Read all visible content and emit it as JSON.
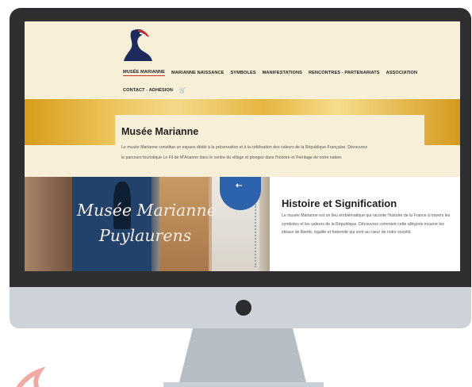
{
  "nav": {
    "items": [
      "MUSÉE MARIANNE",
      "MARIANNE NAISSANCE",
      "SYMBOLES",
      "MANIFESTATIONS",
      "RENCONTRES - PARTENARIATS",
      "ASSOCIATION"
    ],
    "contact": "CONTACT - ADHÉSION",
    "cart_icon": "cart-icon"
  },
  "intro": {
    "title": "Musée Marianne",
    "line1": "Le musée Marianne constitue un espace dédié à la préservation et à la célébration des valeurs de la République Française. Découvrez",
    "line2": "le parcours touristique Le Fil de M'Arianne dans le centre du village et plongez dans l'histoire et l'héritage de notre nation."
  },
  "photo": {
    "title_line1": "Musée Marianne",
    "title_line2": "Puylaurens"
  },
  "history": {
    "title": "Histoire et Signification",
    "text": "Le musée Marianne est un lieu emblématique qui raconte l'histoire de la France à travers les symboles et les valeurs de la République. Découvrez comment cette allégorie incarne les idéaux de liberté, égalité et fraternité qui sont au cœur de notre société."
  },
  "colors": {
    "bezel": "#2f2f31",
    "page_bg": "#f7efd7",
    "gold": "#e5b53f",
    "active_underline": "#c8302c",
    "badge_blue": "#2d62ad"
  }
}
